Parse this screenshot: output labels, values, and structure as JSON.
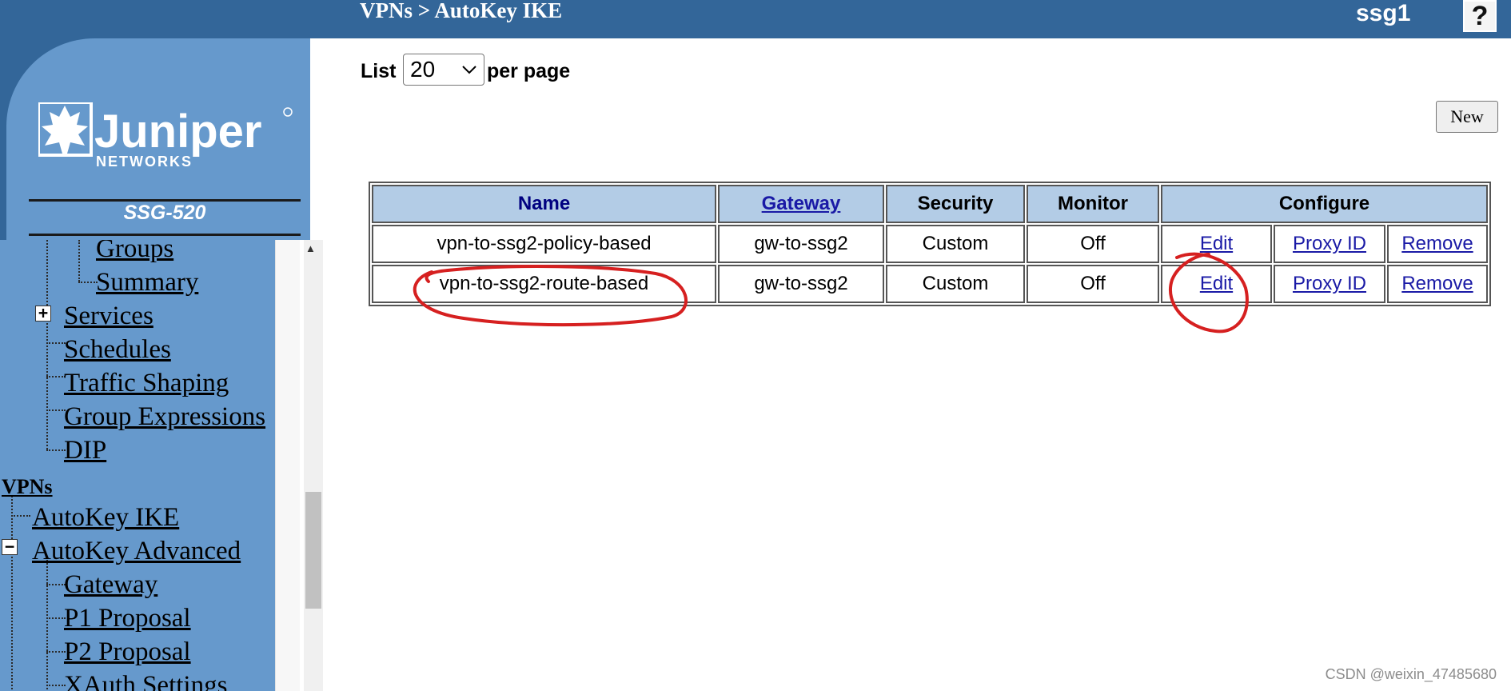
{
  "header": {
    "breadcrumb": "VPNs > AutoKey IKE",
    "hostname": "ssg1",
    "help_label": "?"
  },
  "brand": {
    "logo_text": "Juniper",
    "logo_subtext": "NETWORKS",
    "model": "SSG-520"
  },
  "nav": {
    "groups": "Groups",
    "summary": "Summary",
    "services": "Services",
    "schedules": "Schedules",
    "traffic_shaping": "Traffic Shaping",
    "group_expressions": "Group Expressions",
    "dip": "DIP",
    "vpns": "VPNs",
    "autokey_ike": "AutoKey IKE",
    "autokey_advanced": "AutoKey Advanced",
    "gateway": "Gateway",
    "p1_proposal": "P1 Proposal",
    "p2_proposal": "P2 Proposal",
    "xauth_settings": "XAuth Settings",
    "expand_symbol": "+",
    "collapse_symbol": "−"
  },
  "list": {
    "label": "List",
    "per_page_value": "20",
    "per_page_suffix": "per page"
  },
  "new_button": "New",
  "table": {
    "headers": {
      "name": "Name",
      "gateway": "Gateway",
      "security": "Security",
      "monitor": "Monitor",
      "configure": "Configure"
    },
    "rows": [
      {
        "name": "vpn-to-ssg2-policy-based",
        "gateway": "gw-to-ssg2",
        "security": "Custom",
        "monitor": "Off",
        "edit": "Edit",
        "proxy_id": "Proxy ID",
        "remove": "Remove"
      },
      {
        "name": "vpn-to-ssg2-route-based",
        "gateway": "gw-to-ssg2",
        "security": "Custom",
        "monitor": "Off",
        "edit": "Edit",
        "proxy_id": "Proxy ID",
        "remove": "Remove"
      }
    ]
  },
  "annotation_color": "#d62020",
  "watermark": "CSDN @weixin_47485680"
}
